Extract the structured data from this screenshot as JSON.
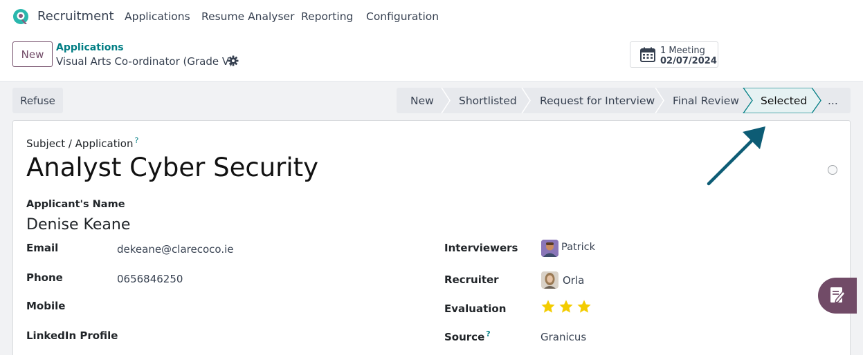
{
  "navbar": {
    "app_name": "Recruitment",
    "menu": [
      "Applications",
      "Resume Analyser",
      "Reporting",
      "Configuration"
    ]
  },
  "control_panel": {
    "new_label": "New",
    "breadcrumb_parent": "Applications",
    "breadcrumb_current": "Visual Arts Co-ordinator (Grade V)",
    "meeting_count": "1 Meeting",
    "meeting_date": "02/07/2024"
  },
  "statusbar": {
    "refuse_label": "Refuse",
    "stages": [
      "New",
      "Shortlisted",
      "Request for Interview",
      "Final Review",
      "Selected"
    ],
    "active_stage": "Selected",
    "more_label": "..."
  },
  "form": {
    "subject_label": "Subject / Application",
    "subject_help": "?",
    "subject_value": "Analyst Cyber Security",
    "applicant_label": "Applicant's Name",
    "applicant_value": "Denise Keane",
    "email_label": "Email",
    "email_value": "dekeane@clarecoco.ie",
    "phone_label": "Phone",
    "phone_value": "0656846250",
    "mobile_label": "Mobile",
    "linkedin_label": "LinkedIn Profile",
    "interviewers_label": "Interviewers",
    "interviewer_name": "Patrick",
    "recruiter_label": "Recruiter",
    "recruiter_name": "Orla",
    "evaluation_label": "Evaluation",
    "evaluation_stars": 3,
    "evaluation_max": 3,
    "source_label": "Source",
    "source_help": "?",
    "source_value": "Granicus"
  },
  "colors": {
    "brand": "#714b67",
    "teal": "#017e84",
    "star": "#f3cc00",
    "arrow": "#0d5c75"
  }
}
